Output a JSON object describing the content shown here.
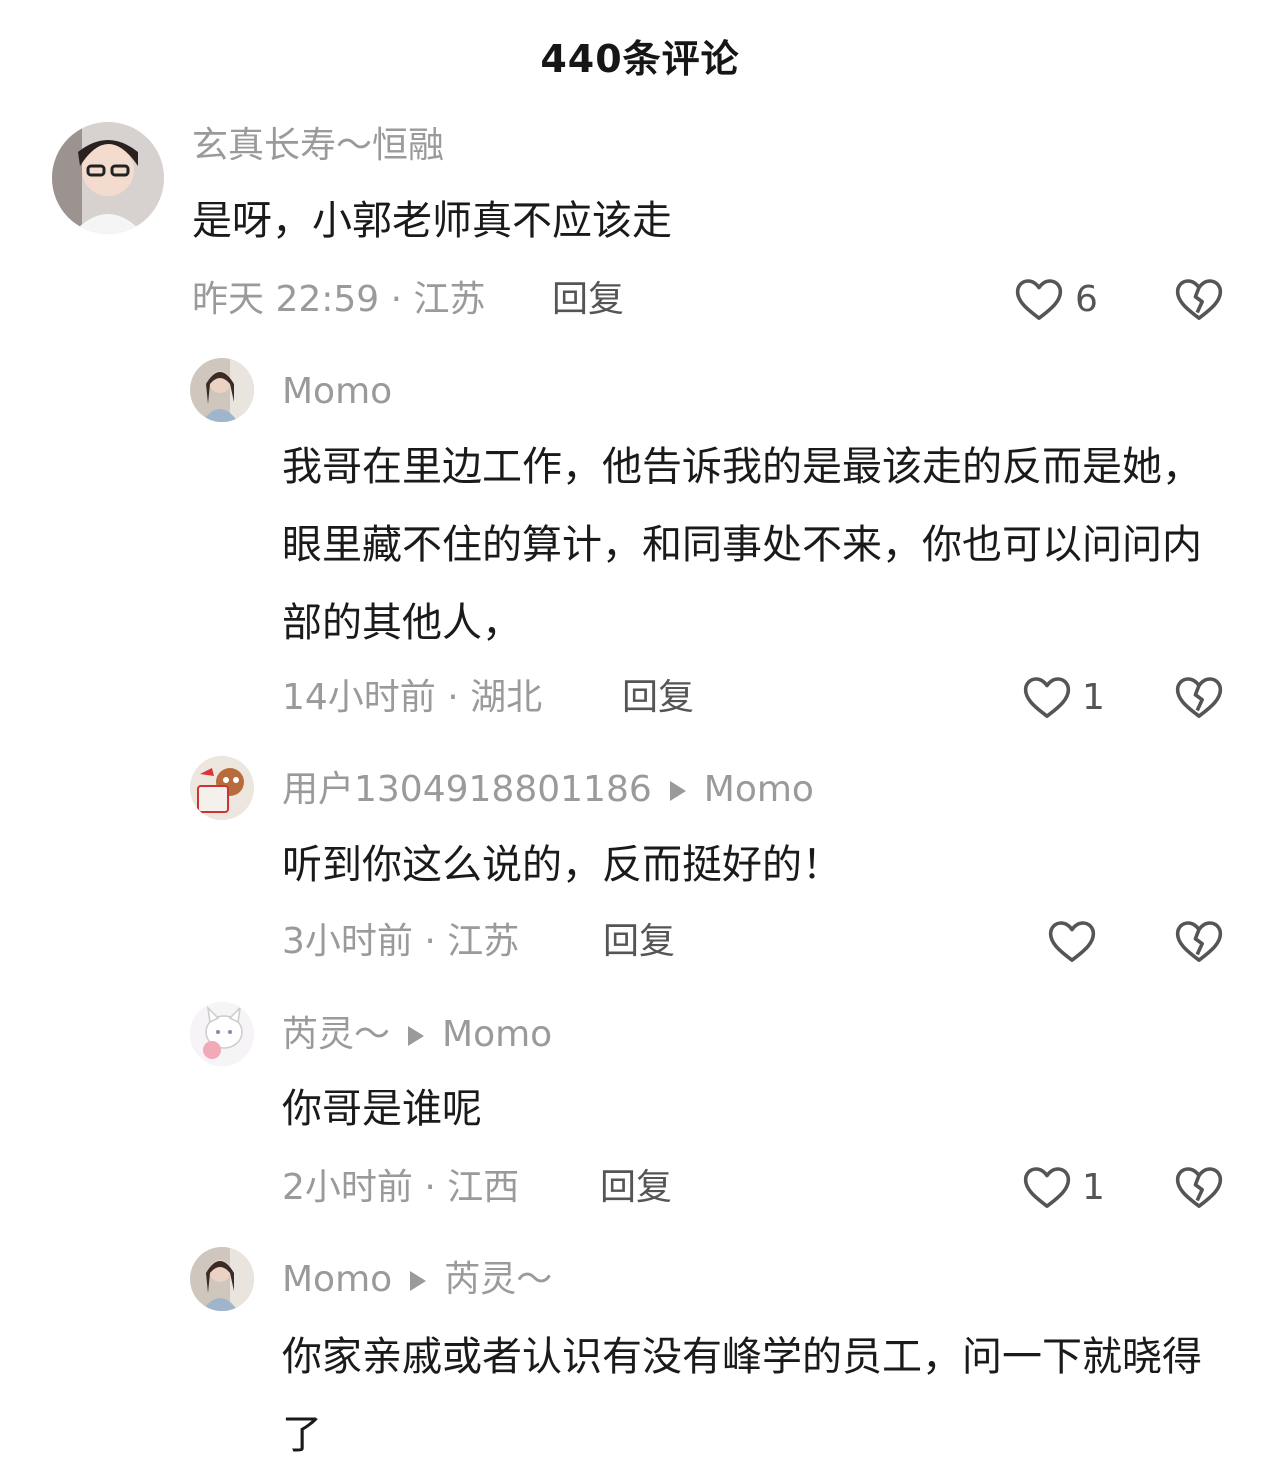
{
  "header": {
    "title": "440条评论"
  },
  "comments": [
    {
      "username": "玄真长寿～恒融",
      "text": "是呀，小郭老师真不应该走",
      "time": "昨天 22:59",
      "location": "江苏",
      "reply_label": "回复",
      "likes": "6"
    },
    {
      "username": "Momo",
      "text": "我哥在里边工作，他告诉我的是最该走的反而是她，眼里藏不住的算计，和同事处不来，你也可以问问内部的其他人，",
      "time": "14小时前",
      "location": "湖北",
      "reply_label": "回复",
      "likes": "1"
    },
    {
      "username": "用户1304918801186",
      "reply_to": "Momo",
      "text": "听到你这么说的，反而挺好的！",
      "time": "3小时前",
      "location": "江苏",
      "reply_label": "回复",
      "likes": ""
    },
    {
      "username": "芮灵～",
      "reply_to": "Momo",
      "text": "你哥是谁呢",
      "time": "2小时前",
      "location": "江西",
      "reply_label": "回复",
      "likes": "1"
    },
    {
      "username": "Momo",
      "reply_to": "芮灵～",
      "text": "你家亲戚或者认识有没有峰学的员工，问一下就晓得了"
    }
  ],
  "meta_separator": " · ",
  "icons": {
    "like": "heart-outline-icon",
    "dislike": "broken-heart-icon"
  },
  "colors": {
    "secondary_text": "#9a9a9a",
    "primary_text": "#1a1a1a",
    "icon_gray": "#555555"
  }
}
